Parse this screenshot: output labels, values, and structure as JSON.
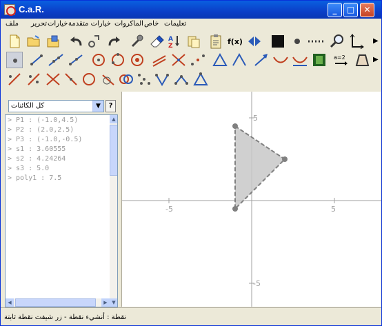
{
  "window": {
    "title": "C.a.R."
  },
  "window_buttons": [
    "_",
    "□",
    "✕"
  ],
  "menubar": {
    "items": [
      "ملف",
      "تحرير",
      "خيارات",
      "خيارات متقدمة",
      "الماكروات",
      "خاص",
      "تعليمات"
    ]
  },
  "toolbar_icons": {
    "row1": [
      "new-file",
      "open-file",
      "save-file",
      "undo",
      "edit-tool",
      "redo",
      "wrench-tool",
      "eraser-tool",
      "sort-az",
      "copy-tool",
      "clipboard-tool",
      "function-tool",
      "flip-tool",
      "black-square",
      "point-dot",
      "dotted-line",
      "zoom-tool",
      "axes-tool"
    ],
    "row2": [
      "point-tool",
      "segment-tool",
      "line-tool",
      "ray-tool",
      "circle-tool",
      "circle3-tool",
      "fixed-circle-tool",
      "parallel-tool",
      "intersection-tool",
      "midpoint-tool",
      "angle-tool",
      "fixed-angle-tool",
      "arrow-tool",
      "curve-tool",
      "function-graph-tool",
      "film-tool",
      "expression-tool",
      "quad-tool"
    ],
    "row3": [
      "perpendicular-tool",
      "bisector-tool",
      "cross-tool",
      "segment-midpoint-tool",
      "circle-point-tool",
      "tangent-tool",
      "circle-intersect-tool",
      "locus-tool",
      "points-tool",
      "polygon-tool",
      "polyline-tool",
      "triangle-tool"
    ]
  },
  "object_filter": {
    "selected": "كل الكائنات",
    "help_label": "?"
  },
  "objects": [
    "> P1 : (-1.0,4.5)",
    "> P2 : (2.0,2.5)",
    "> P3 : (-1.0,-0.5)",
    "> s1 : 3.60555",
    "> s2 : 4.24264",
    "> s3 : 5.0",
    "> poly1 : 7.5"
  ],
  "canvas": {
    "x_ticks": [
      "-5",
      "5"
    ],
    "y_ticks": [
      "5",
      "-5"
    ],
    "triangle_points": [
      [
        -1.0,
        4.5
      ],
      [
        2.0,
        2.5
      ],
      [
        -1.0,
        -0.5
      ]
    ],
    "fill_color": "#c8c8c8",
    "edge_color": "#808080",
    "axis_color": "#a0a0a0"
  },
  "status": {
    "text": "نقطة : أنشيء نقطة - زر شيفت نقطة ثابتة"
  }
}
